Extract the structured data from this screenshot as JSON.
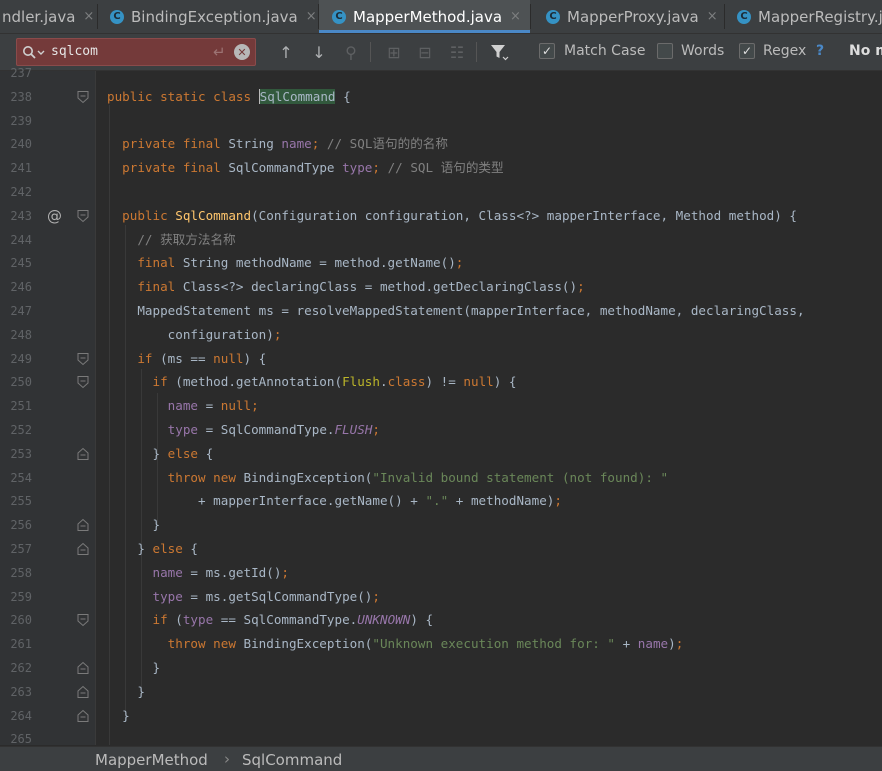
{
  "tabs": [
    {
      "label": "ndler.java",
      "active": false,
      "icon": "class-icon"
    },
    {
      "label": "BindingException.java",
      "active": false,
      "icon": "class-icon"
    },
    {
      "label": "MapperMethod.java",
      "active": true,
      "icon": "class-icon"
    },
    {
      "label": "MapperProxy.java",
      "active": false,
      "icon": "class-icon"
    },
    {
      "label": "MapperRegistry.j",
      "active": false,
      "icon": "class-icon"
    }
  ],
  "tab_close_glyph": "×",
  "tab_class_glyph": "C",
  "find": {
    "query": "sqlcom",
    "options": [
      {
        "label": "Match Case",
        "checked": true
      },
      {
        "label": "Words",
        "checked": false
      },
      {
        "label": "Regex",
        "checked": true
      }
    ],
    "help": "?",
    "status": "No m"
  },
  "line_numbers": [
    "237",
    "238",
    "239",
    "240",
    "241",
    "242",
    "243",
    "244",
    "245",
    "246",
    "247",
    "248",
    "249",
    "250",
    "251",
    "252",
    "253",
    "254",
    "255",
    "256",
    "257",
    "258",
    "259",
    "260",
    "261",
    "262",
    "263",
    "264",
    "265"
  ],
  "code_lines": [
    [],
    [
      {
        "t": "public static class ",
        "c": "kw"
      },
      {
        "t": "SqlCommand",
        "c": "hl"
      },
      {
        "t": " {",
        "c": ""
      }
    ],
    [],
    [
      {
        "t": "  private final ",
        "c": "kw"
      },
      {
        "t": "String ",
        "c": ""
      },
      {
        "t": "name",
        "c": "fld"
      },
      {
        "t": "; ",
        "c": "semi"
      },
      {
        "t": "// SQL语句的的名称",
        "c": "cmt"
      }
    ],
    [
      {
        "t": "  private final ",
        "c": "kw"
      },
      {
        "t": "SqlCommandType ",
        "c": ""
      },
      {
        "t": "type",
        "c": "fld"
      },
      {
        "t": "; ",
        "c": "semi"
      },
      {
        "t": "// SQL 语句的类型",
        "c": "cmt"
      }
    ],
    [],
    [
      {
        "t": "  public ",
        "c": "kw"
      },
      {
        "t": "SqlCommand",
        "c": "mth"
      },
      {
        "t": "(Configuration configuration, Class<?> mapperInterface, Method method) {",
        "c": ""
      }
    ],
    [
      {
        "t": "    // 获取方法名称",
        "c": "cmt"
      }
    ],
    [
      {
        "t": "    final ",
        "c": "kw"
      },
      {
        "t": "String methodName = method.getName()",
        "c": ""
      },
      {
        "t": ";",
        "c": "semi"
      }
    ],
    [
      {
        "t": "    final ",
        "c": "kw"
      },
      {
        "t": "Class<?> declaringClass = method.getDeclaringClass()",
        "c": ""
      },
      {
        "t": ";",
        "c": "semi"
      }
    ],
    [
      {
        "t": "    MappedStatement ms = resolveMappedStatement(mapperInterface, methodName, declaringClass,",
        "c": ""
      }
    ],
    [
      {
        "t": "        configuration)",
        "c": ""
      },
      {
        "t": ";",
        "c": "semi"
      }
    ],
    [
      {
        "t": "    if ",
        "c": "kw"
      },
      {
        "t": "(ms == ",
        "c": ""
      },
      {
        "t": "null",
        "c": "kw"
      },
      {
        "t": ") {",
        "c": ""
      }
    ],
    [
      {
        "t": "      if ",
        "c": "kw"
      },
      {
        "t": "(method.getAnnotation(",
        "c": ""
      },
      {
        "t": "Flush",
        "c": "ann"
      },
      {
        "t": ".",
        "c": ""
      },
      {
        "t": "class",
        "c": "kw"
      },
      {
        "t": ") != ",
        "c": ""
      },
      {
        "t": "null",
        "c": "kw"
      },
      {
        "t": ") {",
        "c": ""
      }
    ],
    [
      {
        "t": "        ",
        "c": ""
      },
      {
        "t": "name ",
        "c": "fld"
      },
      {
        "t": "= ",
        "c": ""
      },
      {
        "t": "null",
        "c": "kw"
      },
      {
        "t": ";",
        "c": "semi"
      }
    ],
    [
      {
        "t": "        ",
        "c": ""
      },
      {
        "t": "type ",
        "c": "fld"
      },
      {
        "t": "= SqlCommandType.",
        "c": ""
      },
      {
        "t": "FLUSH",
        "c": "sfld"
      },
      {
        "t": ";",
        "c": "semi"
      }
    ],
    [
      {
        "t": "      } ",
        "c": ""
      },
      {
        "t": "else ",
        "c": "kw"
      },
      {
        "t": "{",
        "c": ""
      }
    ],
    [
      {
        "t": "        throw new ",
        "c": "kw"
      },
      {
        "t": "BindingException(",
        "c": ""
      },
      {
        "t": "\"Invalid bound statement (not found): \"",
        "c": "str"
      }
    ],
    [
      {
        "t": "            + mapperInterface.getName() + ",
        "c": ""
      },
      {
        "t": "\".\"",
        "c": "str"
      },
      {
        "t": " + methodName)",
        "c": ""
      },
      {
        "t": ";",
        "c": "semi"
      }
    ],
    [
      {
        "t": "      }",
        "c": ""
      }
    ],
    [
      {
        "t": "    } ",
        "c": ""
      },
      {
        "t": "else ",
        "c": "kw"
      },
      {
        "t": "{",
        "c": ""
      }
    ],
    [
      {
        "t": "      ",
        "c": ""
      },
      {
        "t": "name ",
        "c": "fld"
      },
      {
        "t": "= ms.getId()",
        "c": ""
      },
      {
        "t": ";",
        "c": "semi"
      }
    ],
    [
      {
        "t": "      ",
        "c": ""
      },
      {
        "t": "type ",
        "c": "fld"
      },
      {
        "t": "= ms.getSqlCommandType()",
        "c": ""
      },
      {
        "t": ";",
        "c": "semi"
      }
    ],
    [
      {
        "t": "      if ",
        "c": "kw"
      },
      {
        "t": "(",
        "c": ""
      },
      {
        "t": "type ",
        "c": "fld"
      },
      {
        "t": "== SqlCommandType.",
        "c": ""
      },
      {
        "t": "UNKNOWN",
        "c": "sfld"
      },
      {
        "t": ") {",
        "c": ""
      }
    ],
    [
      {
        "t": "        throw new ",
        "c": "kw"
      },
      {
        "t": "BindingException(",
        "c": ""
      },
      {
        "t": "\"Unknown execution method for: \"",
        "c": "str"
      },
      {
        "t": " + ",
        "c": ""
      },
      {
        "t": "name",
        "c": "fld"
      },
      {
        "t": ")",
        "c": ""
      },
      {
        "t": ";",
        "c": "semi"
      }
    ],
    [
      {
        "t": "      }",
        "c": ""
      }
    ],
    [
      {
        "t": "    }",
        "c": ""
      }
    ],
    [
      {
        "t": "  }",
        "c": ""
      }
    ],
    []
  ],
  "gutter_marks": {
    "6": "@"
  },
  "fold_markers": {
    "1": "open",
    "6": "open",
    "12": "open",
    "13": "open",
    "16": "close",
    "19": "close",
    "20": "close",
    "23": "open",
    "25": "close",
    "26": "close",
    "27": "close"
  },
  "breadcrumb": [
    "MapperMethod",
    "SqlCommand"
  ],
  "colors": {
    "keyword": "#cc7832",
    "field": "#9876aa",
    "string": "#6a8759",
    "comment": "#808080",
    "annotation": "#bbb529",
    "method": "#ffc66d",
    "search_error_bg": "#743a3a",
    "accent": "#4a88c7"
  }
}
